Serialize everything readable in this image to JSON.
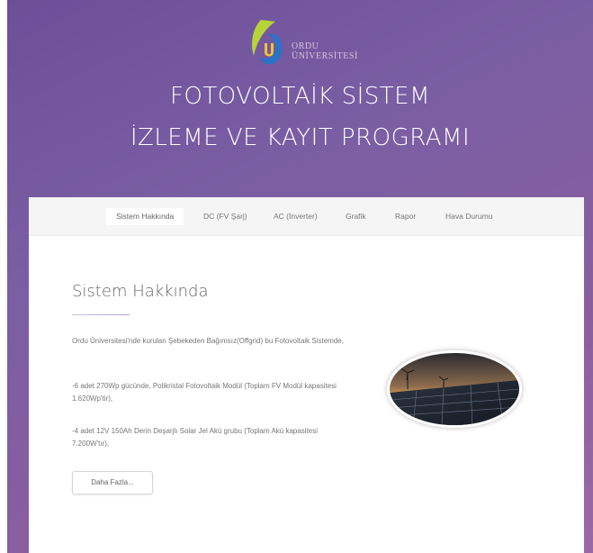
{
  "logo": {
    "line1": "ORDU",
    "line2": "ÜNİVERSİTESİ"
  },
  "header": {
    "title_line1": "FOTOVOLTAİK SİSTEM",
    "title_line2": "İZLEME VE KAYIT PROGRAMI"
  },
  "nav": {
    "items": [
      {
        "label": "Sistem Hakkında"
      },
      {
        "label": "DC (FV Şarj)"
      },
      {
        "label": "AC (İnverter)"
      },
      {
        "label": "Grafik"
      },
      {
        "label": "Rapor"
      },
      {
        "label": "Hava Durumu"
      }
    ],
    "active_index": 0
  },
  "section": {
    "heading": "Sistem Hakkında",
    "paragraphs": [
      "Ordu Üniversitesi'nde kurulan Şebekeden Bağımsız(Offgrid) bu Fotovoltaik Sistemde,",
      "-6 adet 270Wp gücünde, Polikristal Fotovoltaik Modül (Toplam FV Modül kapasitesi 1.620Wp'tir),",
      "-4 adet 12V 150Ah Derin Deşarjlı Solar Jel Akü grubu (Toplam Akü kapasitesi 7.200W'tır),"
    ],
    "more_button": "Daha Fazla..."
  },
  "colors": {
    "background_gradient": [
      "#6d4f98",
      "#9a6aa6"
    ],
    "logo_green": "#b7d33a",
    "logo_blue": "#2a73c8"
  },
  "icons": {
    "logo": "ordu-university-logo-icon",
    "photo": "solar-panel-photo"
  }
}
